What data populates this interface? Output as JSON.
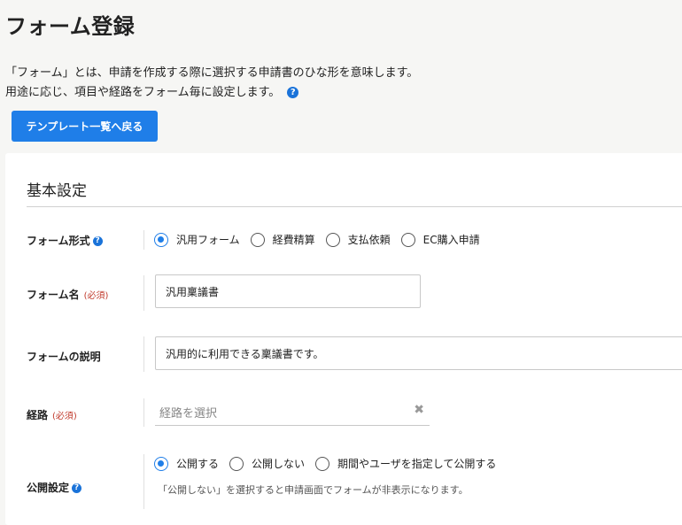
{
  "page": {
    "title": "フォーム登録",
    "description_line1": "「フォーム」とは、申請を作成する際に選択する申請書のひな形を意味します。",
    "description_line2": "用途に応じ、項目や経路をフォーム毎に設定します。",
    "help_icon": "question-circle-icon",
    "back_button_label": "テンプレート一覧へ戻る"
  },
  "section": {
    "title": "基本設定"
  },
  "required_label": "(必須)",
  "form_type": {
    "label": "フォーム形式",
    "options": [
      {
        "label": "汎用フォーム",
        "checked": true
      },
      {
        "label": "経費精算",
        "checked": false
      },
      {
        "label": "支払依頼",
        "checked": false
      },
      {
        "label": "EC購入申請",
        "checked": false
      }
    ]
  },
  "form_name": {
    "label": "フォーム名",
    "value": "汎用稟議書"
  },
  "form_description": {
    "label": "フォームの説明",
    "value": "汎用的に利用できる稟議書です。"
  },
  "route": {
    "label": "経路",
    "placeholder": "経路を選択",
    "clear_icon": "clear-x-icon"
  },
  "visibility": {
    "label": "公開設定",
    "options": [
      {
        "label": "公開する",
        "checked": true
      },
      {
        "label": "公開しない",
        "checked": false
      },
      {
        "label": "期間やユーザを指定して公開する",
        "checked": false
      }
    ],
    "note": "「公開しない」を選択すると申請画面でフォームが非表示になります。"
  },
  "colors": {
    "accent": "#1f7ee8",
    "required": "#c0392b",
    "background": "#f6f6f4"
  }
}
